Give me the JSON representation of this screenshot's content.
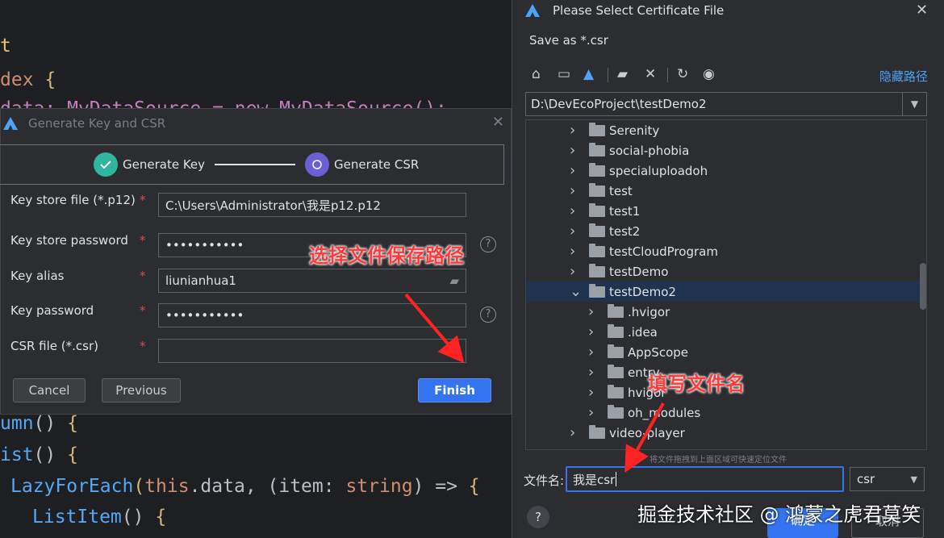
{
  "code_lines": {
    "l1": "t",
    "l2a": "dex ",
    "l2b": "{",
    "l3a": "data: MyDataSource = new MyDataSource();",
    "l4a": "umn",
    "l4b": "() ",
    "l4c": "{",
    "l5a": "ist",
    "l5b": "() ",
    "l5c": "{",
    "l6a": "LazyForEach",
    "l6b": "(",
    "l6c": "this",
    ".": ".",
    "l6d": ".data, (item: ",
    "l6e": "string",
    "l6f": ") => ",
    "l6g": "{",
    "l7a": "ListItem",
    "l7b": "() ",
    "l7c": "{"
  },
  "key_dialog": {
    "title": "Generate Key and CSR",
    "step1": "Generate Key",
    "step2": "Generate CSR",
    "fields": [
      {
        "label": "Key store file (*.p12)",
        "value": "C:\\Users\\Administrator\\我是p12.p12"
      },
      {
        "label": "Key store password",
        "value": "•••••••••••"
      },
      {
        "label": "Key alias",
        "value": "liunianhua1"
      },
      {
        "label": "Key password",
        "value": "•••••••••••"
      },
      {
        "label": "CSR file (*.csr)",
        "value": ""
      }
    ],
    "required_mark": "*",
    "help": "?",
    "cancel": "Cancel",
    "previous": "Previous",
    "finish": "Finish"
  },
  "file_dialog": {
    "title": "Please Select Certificate File",
    "save_as": "Save as *.csr",
    "hide_path": "隐藏路径",
    "path": "D:\\DevEcoProject\\testDemo2",
    "tree": [
      {
        "name": "Serenity",
        "level": 0,
        "expanded": false
      },
      {
        "name": "social-phobia",
        "level": 0,
        "expanded": false
      },
      {
        "name": "specialuploadoh",
        "level": 0,
        "expanded": false
      },
      {
        "name": "test",
        "level": 0,
        "expanded": false
      },
      {
        "name": "test1",
        "level": 0,
        "expanded": false
      },
      {
        "name": "test2",
        "level": 0,
        "expanded": false
      },
      {
        "name": "testCloudProgram",
        "level": 0,
        "expanded": false
      },
      {
        "name": "testDemo",
        "level": 0,
        "expanded": false
      },
      {
        "name": "testDemo2",
        "level": 0,
        "expanded": true,
        "selected": true
      },
      {
        "name": ".hvigor",
        "level": 1,
        "expanded": false
      },
      {
        "name": ".idea",
        "level": 1,
        "expanded": false
      },
      {
        "name": "AppScope",
        "level": 1,
        "expanded": false
      },
      {
        "name": "entry",
        "level": 1,
        "expanded": false
      },
      {
        "name": "hvigor",
        "level": 1,
        "expanded": false
      },
      {
        "name": "oh_modules",
        "level": 1,
        "expanded": false
      },
      {
        "name": "video-player",
        "level": 0,
        "expanded": false
      }
    ],
    "drag_hint": "将文件拖拽到上面区域可快速定位文件",
    "filename_label": "文件名:",
    "filename_value": "我是csr",
    "ext_value": "csr",
    "ok": "确定",
    "cancel": "取消",
    "help": "?"
  },
  "annotations": {
    "path_note": "选择文件保存路径",
    "name_note": "填写文件名",
    "watermark": "掘金技术社区 @ 鸿蒙之虎君莫笑"
  },
  "colors": {
    "accent": "#3574f0",
    "required": "#d94f4f",
    "annotation": "#ff3b3b",
    "selected_row": "#1f3350"
  }
}
